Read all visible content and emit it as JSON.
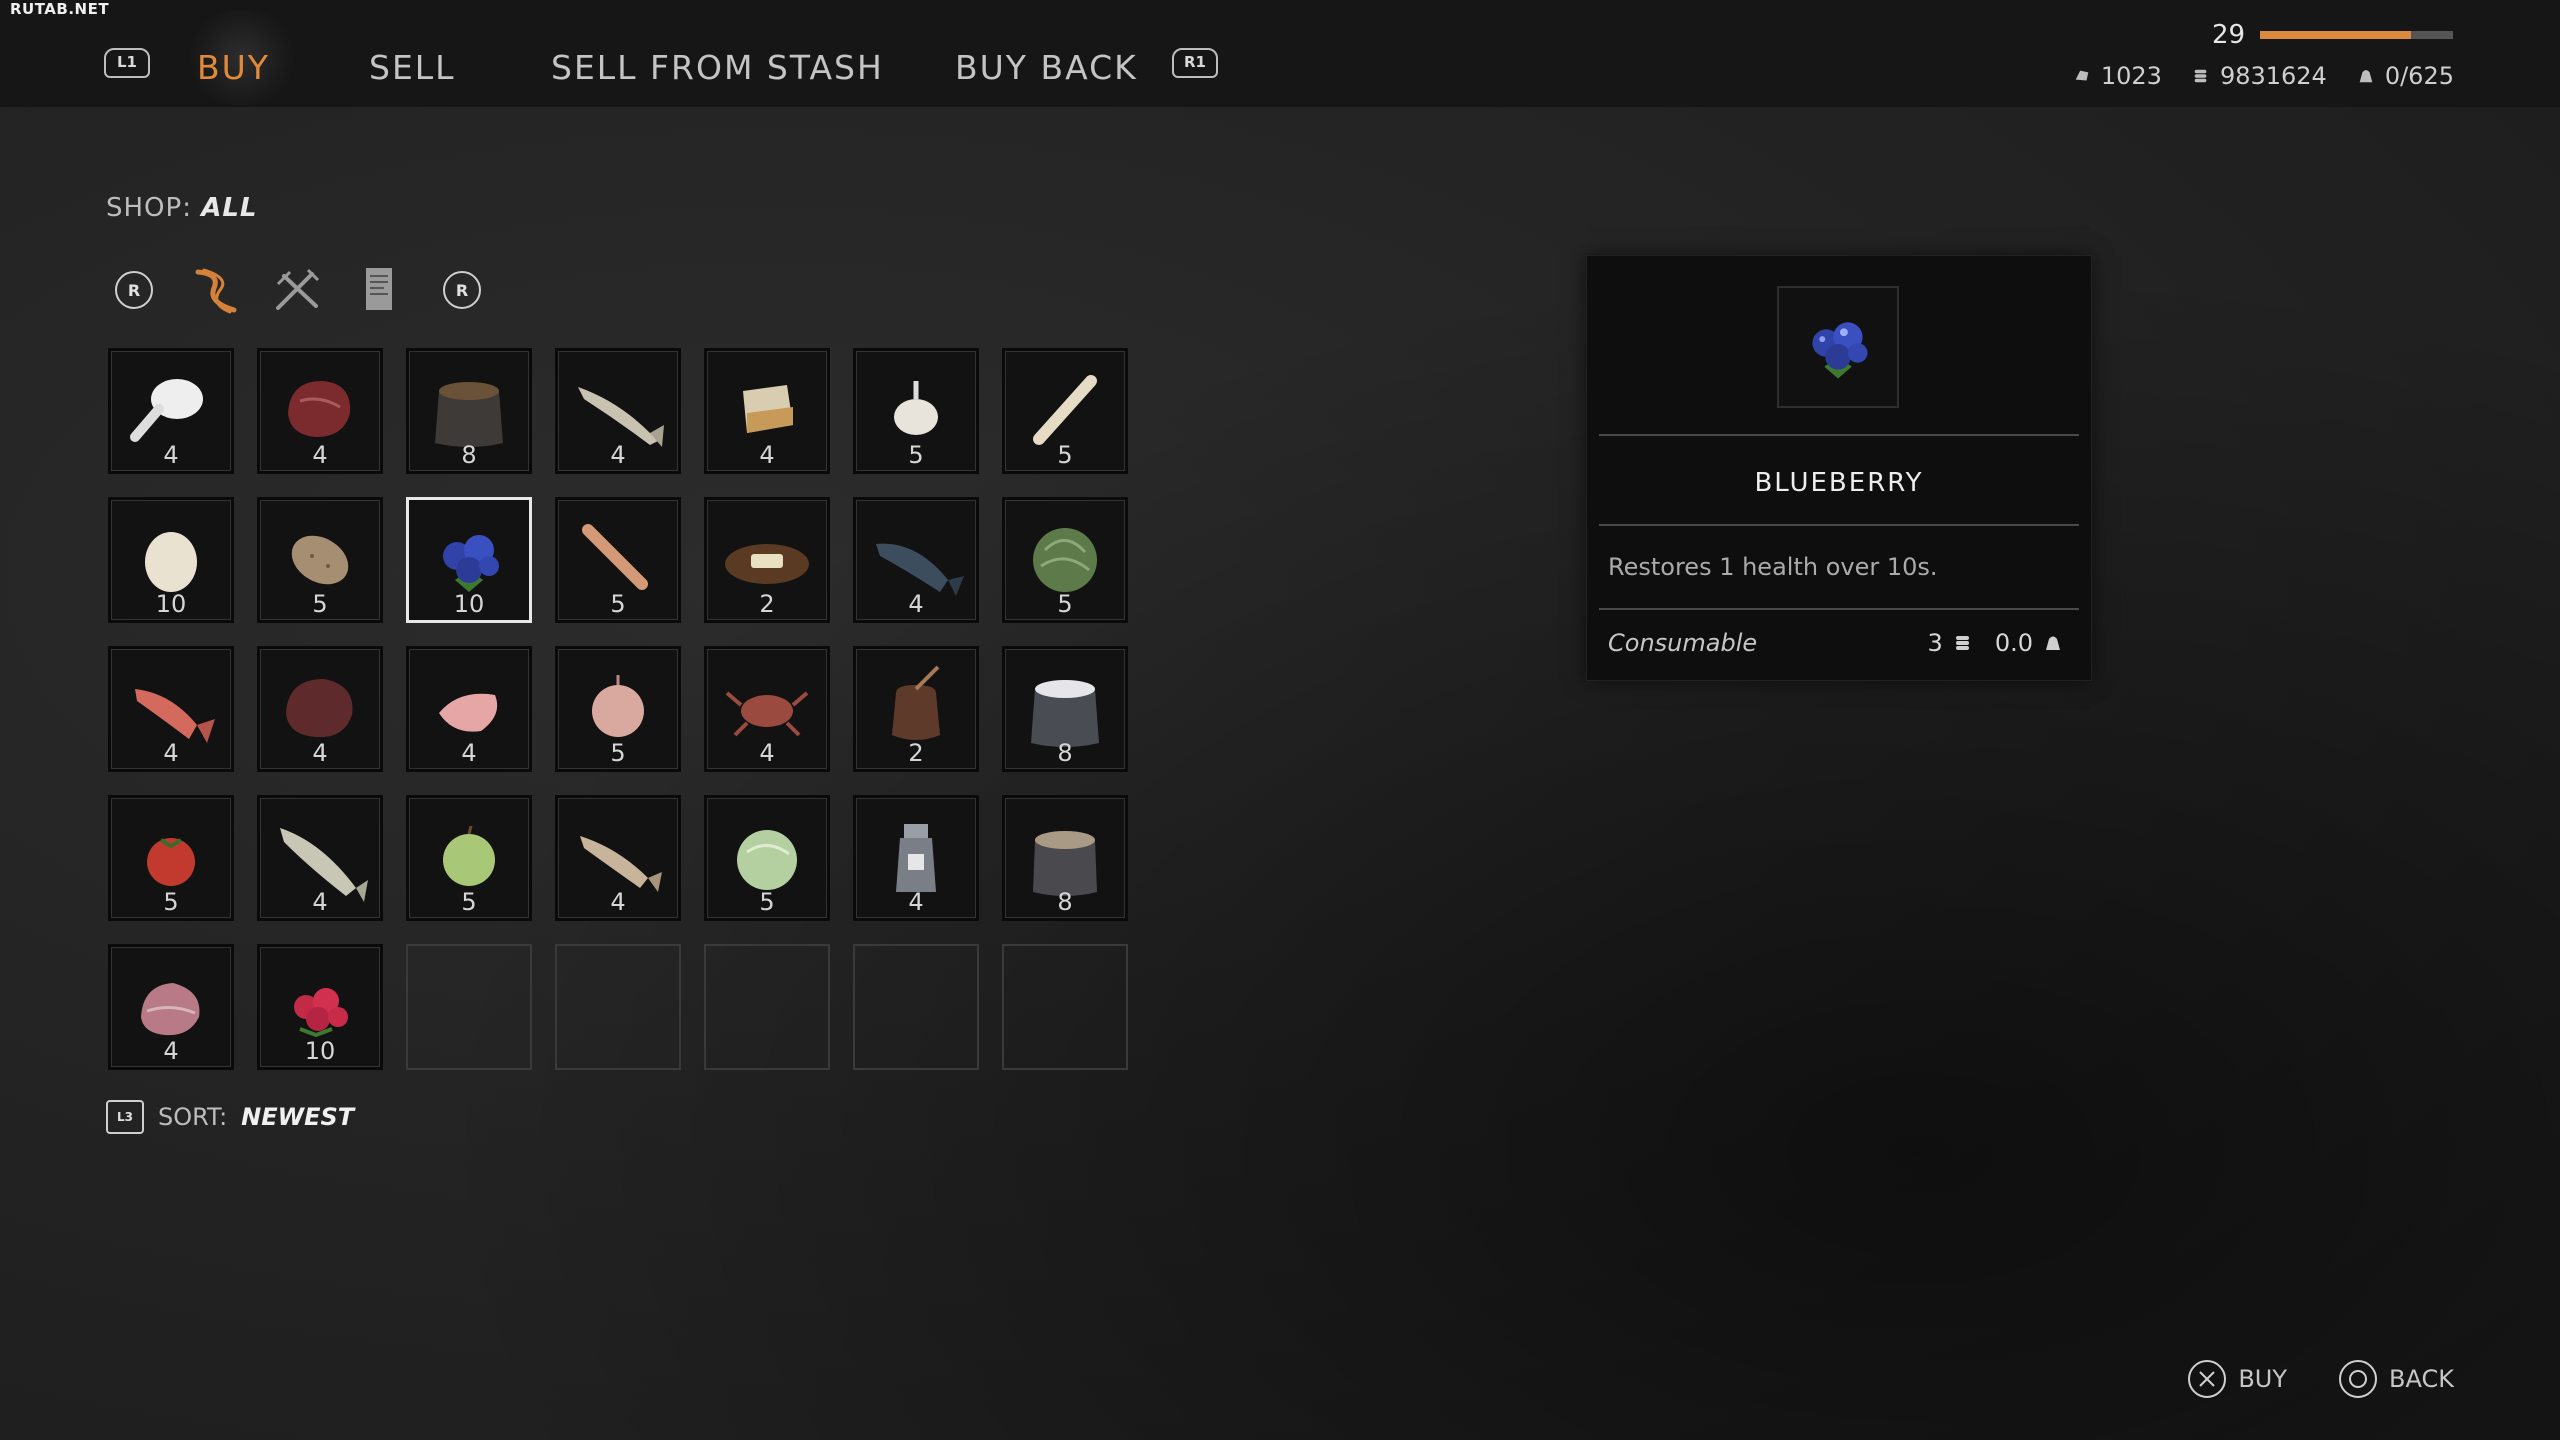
{
  "watermark": "RUTAB.NET",
  "header": {
    "left_button": "L1",
    "right_button": "R1",
    "tabs": [
      {
        "label": "BUY",
        "active": true
      },
      {
        "label": "SELL",
        "active": false
      },
      {
        "label": "SELL FROM STASH",
        "active": false
      },
      {
        "label": "BUY BACK",
        "active": false
      }
    ],
    "level": "29",
    "xp_progress": 0.78,
    "stats": {
      "resource": "1023",
      "coins": "9831624",
      "weight": "0/625"
    },
    "accent_color": "#e08a3a"
  },
  "shop": {
    "prefix": "SHOP:",
    "value": "ALL"
  },
  "filters": {
    "prev_button": "R",
    "next_button": "R",
    "icons": [
      "rope-icon",
      "tools-icon",
      "scroll-icon"
    ]
  },
  "grid": {
    "items": [
      {
        "name": "chicken-leg",
        "qty": "4"
      },
      {
        "name": "raw-meat",
        "qty": "4"
      },
      {
        "name": "grain-sack",
        "qty": "8"
      },
      {
        "name": "fish-white",
        "qty": "4"
      },
      {
        "name": "cheese",
        "qty": "4"
      },
      {
        "name": "garlic",
        "qty": "5"
      },
      {
        "name": "parsnip",
        "qty": "5"
      },
      {
        "name": "egg",
        "qty": "10"
      },
      {
        "name": "potato",
        "qty": "5"
      },
      {
        "name": "blueberry",
        "qty": "10",
        "selected": true
      },
      {
        "name": "carrot",
        "qty": "5"
      },
      {
        "name": "butter-plate",
        "qty": "2"
      },
      {
        "name": "fish-dark",
        "qty": "4"
      },
      {
        "name": "cabbage",
        "qty": "5"
      },
      {
        "name": "red-fish",
        "qty": "4"
      },
      {
        "name": "beef-chunk",
        "qty": "4"
      },
      {
        "name": "pork-slice",
        "qty": "4"
      },
      {
        "name": "onion",
        "qty": "5"
      },
      {
        "name": "crab",
        "qty": "4"
      },
      {
        "name": "honey-jar",
        "qty": "2"
      },
      {
        "name": "salt-sack",
        "qty": "8"
      },
      {
        "name": "tomato",
        "qty": "5"
      },
      {
        "name": "fish-pike",
        "qty": "4"
      },
      {
        "name": "apple",
        "qty": "5"
      },
      {
        "name": "fish-small",
        "qty": "4"
      },
      {
        "name": "lettuce",
        "qty": "5"
      },
      {
        "name": "milk-can",
        "qty": "4"
      },
      {
        "name": "flour-sack",
        "qty": "8"
      },
      {
        "name": "ham",
        "qty": "4"
      },
      {
        "name": "raspberry",
        "qty": "10"
      }
    ],
    "empty_slots": 5
  },
  "sort": {
    "button": "L3",
    "prefix": "SORT:",
    "value": "NEWEST"
  },
  "details": {
    "name": "BLUEBERRY",
    "description": "Restores 1 health over 10s.",
    "type": "Consumable",
    "price": "3",
    "weight": "0.0"
  },
  "prompts": {
    "buy": "BUY",
    "back": "BACK"
  }
}
